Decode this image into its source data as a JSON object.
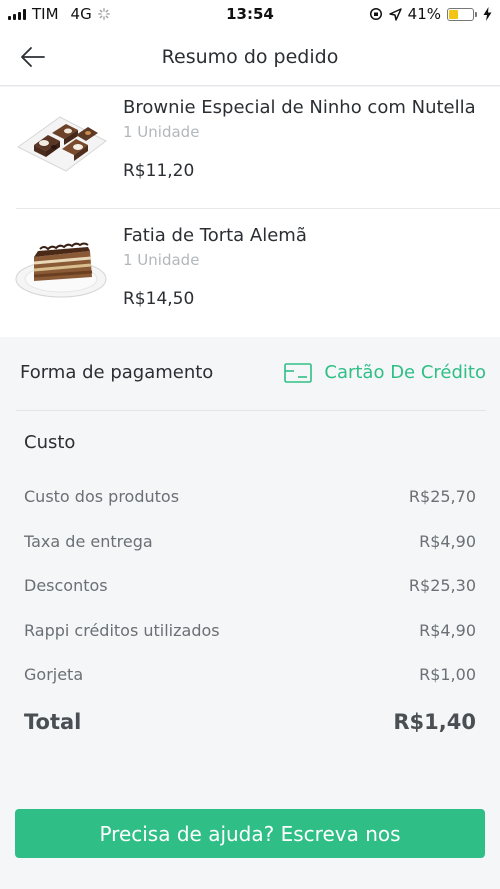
{
  "status_bar": {
    "carrier": "TIM",
    "network": "4G",
    "time": "13:54",
    "battery_percent": "41%",
    "battery_level": 0.41,
    "battery_color": "#f2c515"
  },
  "header": {
    "title": "Resumo do pedido",
    "back_icon": "arrow-left-icon"
  },
  "products": [
    {
      "name": "Brownie Especial de Ninho com Nutella",
      "quantity": "1 Unidade",
      "price": "R$11,20",
      "image": "brownie-plate-image"
    },
    {
      "name": "Fatia de Torta Alemã",
      "quantity": "1 Unidade",
      "price": "R$14,50",
      "image": "cake-slice-plate-image"
    }
  ],
  "payment": {
    "label": "Forma de pagamento",
    "method": "Cartão De Crédito",
    "icon": "credit-card-icon"
  },
  "cost": {
    "title": "Custo",
    "rows": [
      {
        "label": "Custo dos produtos",
        "value": "R$25,70"
      },
      {
        "label": "Taxa de entrega",
        "value": "R$4,90"
      },
      {
        "label": "Descontos",
        "value": "R$25,30"
      },
      {
        "label": "Rappi créditos utilizados",
        "value": "R$4,90"
      },
      {
        "label": "Gorjeta",
        "value": "R$1,00"
      }
    ],
    "total_label": "Total",
    "total_value": "R$1,40"
  },
  "help_button": {
    "label": "Precisa de ajuda? Escreva nos"
  },
  "colors": {
    "accent": "#2fbf86",
    "background": "#f5f6f8"
  }
}
